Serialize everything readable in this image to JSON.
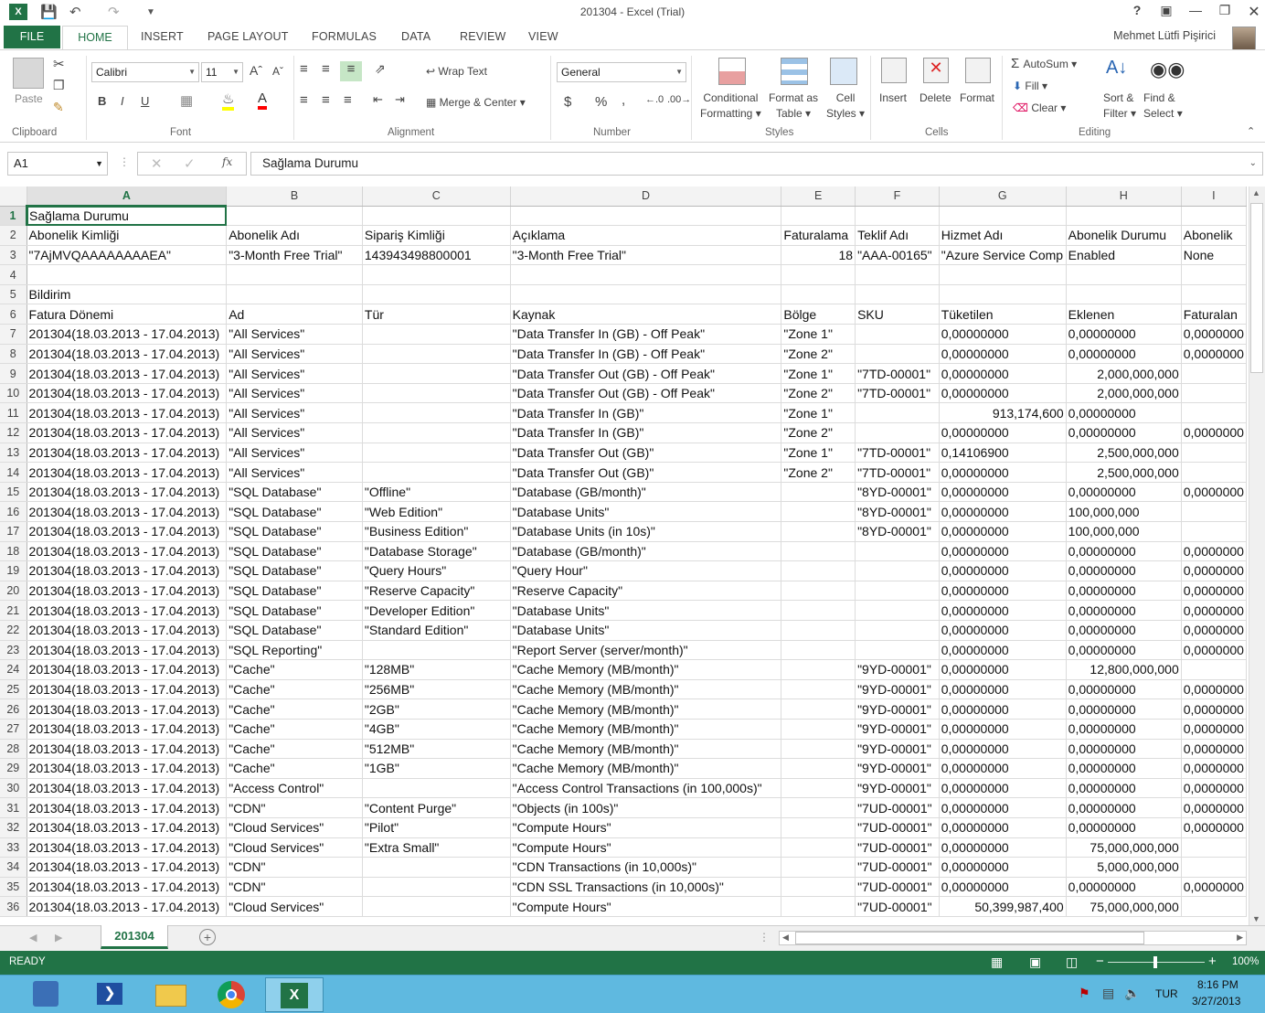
{
  "window": {
    "title": "201304 - Excel (Trial)",
    "user": "Mehmet Lütfi Pişirici"
  },
  "tabs": [
    "FILE",
    "HOME",
    "INSERT",
    "PAGE LAYOUT",
    "FORMULAS",
    "DATA",
    "REVIEW",
    "VIEW"
  ],
  "ribbon": {
    "clipboard": {
      "label": "Clipboard",
      "paste": "Paste"
    },
    "font": {
      "label": "Font",
      "name": "Calibri",
      "size": "11",
      "bold": "B",
      "italic": "I",
      "underline": "U"
    },
    "alignment": {
      "label": "Alignment",
      "wrap_text": "Wrap Text",
      "merge_center": "Merge & Center"
    },
    "number": {
      "label": "Number",
      "format": "General",
      "currency": "$",
      "percent": "%",
      "comma": ","
    },
    "styles": {
      "label": "Styles",
      "conditional_1": "Conditional",
      "conditional_2": "Formatting",
      "format_table_1": "Format as",
      "format_table_2": "Table",
      "cell_styles_1": "Cell",
      "cell_styles_2": "Styles"
    },
    "cells": {
      "label": "Cells",
      "insert": "Insert",
      "delete": "Delete",
      "format": "Format"
    },
    "editing": {
      "label": "Editing",
      "autosum": "AutoSum",
      "fill": "Fill",
      "clear": "Clear",
      "sort_1": "Sort &",
      "sort_2": "Filter",
      "find_1": "Find &",
      "find_2": "Select"
    }
  },
  "formula_bar": {
    "name_box": "A1",
    "fx": "fx",
    "content": "Sağlama Durumu"
  },
  "columns": [
    "A",
    "B",
    "C",
    "D",
    "E",
    "F",
    "G",
    "H",
    "I"
  ],
  "rows": [
    {
      "n": "1",
      "c": [
        "Sağlama Durumu",
        "",
        "",
        "",
        "",
        "",
        "",
        "",
        ""
      ]
    },
    {
      "n": "2",
      "c": [
        "Abonelik Kimliği",
        "Abonelik Adı",
        "Sipariş Kimliği",
        "Açıklama",
        "Faturalama",
        "Teklif Adı",
        "Hizmet Adı",
        "Abonelik Durumu",
        "Abonelik"
      ]
    },
    {
      "n": "3",
      "c": [
        "\"7AjMVQAAAAAAAAEA\"",
        "\"3-Month Free Trial\"",
        "143943498800001",
        "\"3-Month Free Trial\"",
        "18",
        "\"AAA-00165\"",
        "\"Azure Service Comp",
        "Enabled",
        "None"
      ]
    },
    {
      "n": "4",
      "c": [
        "",
        "",
        "",
        "",
        "",
        "",
        "",
        "",
        ""
      ]
    },
    {
      "n": "5",
      "c": [
        "Bildirim",
        "",
        "",
        "",
        "",
        "",
        "",
        "",
        ""
      ]
    },
    {
      "n": "6",
      "c": [
        "Fatura Dönemi",
        "Ad",
        "Tür",
        "Kaynak",
        "Bölge",
        "SKU",
        "Tüketilen",
        "Eklenen",
        "Faturalan"
      ]
    },
    {
      "n": "7",
      "c": [
        "201304(18.03.2013 - 17.04.2013)",
        "\"All Services\"",
        "",
        "\"Data Transfer In (GB) - Off Peak\"",
        "\"Zone 1\"",
        "",
        "0,00000000",
        "0,00000000",
        "0,0000000"
      ]
    },
    {
      "n": "8",
      "c": [
        "201304(18.03.2013 - 17.04.2013)",
        "\"All Services\"",
        "",
        "\"Data Transfer In (GB) - Off Peak\"",
        "\"Zone 2\"",
        "",
        "0,00000000",
        "0,00000000",
        "0,0000000"
      ]
    },
    {
      "n": "9",
      "c": [
        "201304(18.03.2013 - 17.04.2013)",
        "\"All Services\"",
        "",
        "\"Data Transfer Out (GB) - Off Peak\"",
        "\"Zone 1\"",
        "\"7TD-00001\"",
        "0,00000000",
        "2,000,000,000",
        ""
      ]
    },
    {
      "n": "10",
      "c": [
        "201304(18.03.2013 - 17.04.2013)",
        "\"All Services\"",
        "",
        "\"Data Transfer Out (GB) - Off Peak\"",
        "\"Zone 2\"",
        "\"7TD-00001\"",
        "0,00000000",
        "2,000,000,000",
        ""
      ]
    },
    {
      "n": "11",
      "c": [
        "201304(18.03.2013 - 17.04.2013)",
        "\"All Services\"",
        "",
        "\"Data Transfer In (GB)\"",
        "\"Zone 1\"",
        "",
        "913,174,600",
        "0,00000000",
        ""
      ]
    },
    {
      "n": "12",
      "c": [
        "201304(18.03.2013 - 17.04.2013)",
        "\"All Services\"",
        "",
        "\"Data Transfer In (GB)\"",
        "\"Zone 2\"",
        "",
        "0,00000000",
        "0,00000000",
        "0,0000000"
      ]
    },
    {
      "n": "13",
      "c": [
        "201304(18.03.2013 - 17.04.2013)",
        "\"All Services\"",
        "",
        "\"Data Transfer Out (GB)\"",
        "\"Zone 1\"",
        "\"7TD-00001\"",
        "0,14106900",
        "2,500,000,000",
        ""
      ]
    },
    {
      "n": "14",
      "c": [
        "201304(18.03.2013 - 17.04.2013)",
        "\"All Services\"",
        "",
        "\"Data Transfer Out (GB)\"",
        "\"Zone 2\"",
        "\"7TD-00001\"",
        "0,00000000",
        "2,500,000,000",
        ""
      ]
    },
    {
      "n": "15",
      "c": [
        "201304(18.03.2013 - 17.04.2013)",
        "\"SQL Database\"",
        "\"Offline\"",
        "\"Database (GB/month)\"",
        "",
        "\"8YD-00001\"",
        "0,00000000",
        "0,00000000",
        "0,0000000"
      ]
    },
    {
      "n": "16",
      "c": [
        "201304(18.03.2013 - 17.04.2013)",
        "\"SQL Database\"",
        "\"Web Edition\"",
        "\"Database Units\"",
        "",
        "\"8YD-00001\"",
        "0,00000000",
        "100,000,000",
        ""
      ]
    },
    {
      "n": "17",
      "c": [
        "201304(18.03.2013 - 17.04.2013)",
        "\"SQL Database\"",
        "\"Business Edition\"",
        "\"Database Units (in 10s)\"",
        "",
        "\"8YD-00001\"",
        "0,00000000",
        "100,000,000",
        ""
      ]
    },
    {
      "n": "18",
      "c": [
        "201304(18.03.2013 - 17.04.2013)",
        "\"SQL Database\"",
        "\"Database Storage\"",
        "\"Database (GB/month)\"",
        "",
        "",
        "0,00000000",
        "0,00000000",
        "0,0000000"
      ]
    },
    {
      "n": "19",
      "c": [
        "201304(18.03.2013 - 17.04.2013)",
        "\"SQL Database\"",
        "\"Query Hours\"",
        "\"Query Hour\"",
        "",
        "",
        "0,00000000",
        "0,00000000",
        "0,0000000"
      ]
    },
    {
      "n": "20",
      "c": [
        "201304(18.03.2013 - 17.04.2013)",
        "\"SQL Database\"",
        "\"Reserve Capacity\"",
        "\"Reserve Capacity\"",
        "",
        "",
        "0,00000000",
        "0,00000000",
        "0,0000000"
      ]
    },
    {
      "n": "21",
      "c": [
        "201304(18.03.2013 - 17.04.2013)",
        "\"SQL Database\"",
        "\"Developer Edition\"",
        "\"Database Units\"",
        "",
        "",
        "0,00000000",
        "0,00000000",
        "0,0000000"
      ]
    },
    {
      "n": "22",
      "c": [
        "201304(18.03.2013 - 17.04.2013)",
        "\"SQL Database\"",
        "\"Standard Edition\"",
        "\"Database Units\"",
        "",
        "",
        "0,00000000",
        "0,00000000",
        "0,0000000"
      ]
    },
    {
      "n": "23",
      "c": [
        "201304(18.03.2013 - 17.04.2013)",
        "\"SQL Reporting\"",
        "",
        "\"Report Server (server/month)\"",
        "",
        "",
        "0,00000000",
        "0,00000000",
        "0,0000000"
      ]
    },
    {
      "n": "24",
      "c": [
        "201304(18.03.2013 - 17.04.2013)",
        "\"Cache\"",
        "\"128MB\"",
        "\"Cache Memory (MB/month)\"",
        "",
        "\"9YD-00001\"",
        "0,00000000",
        "12,800,000,000",
        ""
      ]
    },
    {
      "n": "25",
      "c": [
        "201304(18.03.2013 - 17.04.2013)",
        "\"Cache\"",
        "\"256MB\"",
        "\"Cache Memory (MB/month)\"",
        "",
        "\"9YD-00001\"",
        "0,00000000",
        "0,00000000",
        "0,0000000"
      ]
    },
    {
      "n": "26",
      "c": [
        "201304(18.03.2013 - 17.04.2013)",
        "\"Cache\"",
        "\"2GB\"",
        "\"Cache Memory (MB/month)\"",
        "",
        "\"9YD-00001\"",
        "0,00000000",
        "0,00000000",
        "0,0000000"
      ]
    },
    {
      "n": "27",
      "c": [
        "201304(18.03.2013 - 17.04.2013)",
        "\"Cache\"",
        "\"4GB\"",
        "\"Cache Memory (MB/month)\"",
        "",
        "\"9YD-00001\"",
        "0,00000000",
        "0,00000000",
        "0,0000000"
      ]
    },
    {
      "n": "28",
      "c": [
        "201304(18.03.2013 - 17.04.2013)",
        "\"Cache\"",
        "\"512MB\"",
        "\"Cache Memory (MB/month)\"",
        "",
        "\"9YD-00001\"",
        "0,00000000",
        "0,00000000",
        "0,0000000"
      ]
    },
    {
      "n": "29",
      "c": [
        "201304(18.03.2013 - 17.04.2013)",
        "\"Cache\"",
        "\"1GB\"",
        "\"Cache Memory (MB/month)\"",
        "",
        "\"9YD-00001\"",
        "0,00000000",
        "0,00000000",
        "0,0000000"
      ]
    },
    {
      "n": "30",
      "c": [
        "201304(18.03.2013 - 17.04.2013)",
        "\"Access Control\"",
        "",
        "\"Access Control Transactions (in 100,000s)\"",
        "",
        "\"9YD-00001\"",
        "0,00000000",
        "0,00000000",
        "0,0000000"
      ]
    },
    {
      "n": "31",
      "c": [
        "201304(18.03.2013 - 17.04.2013)",
        "\"CDN\"",
        "\"Content Purge\"",
        "\"Objects (in 100s)\"",
        "",
        "\"7UD-00001\"",
        "0,00000000",
        "0,00000000",
        "0,0000000"
      ]
    },
    {
      "n": "32",
      "c": [
        "201304(18.03.2013 - 17.04.2013)",
        "\"Cloud Services\"",
        "\"Pilot\"",
        "\"Compute Hours\"",
        "",
        "\"7UD-00001\"",
        "0,00000000",
        "0,00000000",
        "0,0000000"
      ]
    },
    {
      "n": "33",
      "c": [
        "201304(18.03.2013 - 17.04.2013)",
        "\"Cloud Services\"",
        "\"Extra Small\"",
        "\"Compute Hours\"",
        "",
        "\"7UD-00001\"",
        "0,00000000",
        "75,000,000,000",
        ""
      ]
    },
    {
      "n": "34",
      "c": [
        "201304(18.03.2013 - 17.04.2013)",
        "\"CDN\"",
        "",
        "\"CDN Transactions (in 10,000s)\"",
        "",
        "\"7UD-00001\"",
        "0,00000000",
        "5,000,000,000",
        ""
      ]
    },
    {
      "n": "35",
      "c": [
        "201304(18.03.2013 - 17.04.2013)",
        "\"CDN\"",
        "",
        "\"CDN SSL Transactions (in 10,000s)\"",
        "",
        "\"7UD-00001\"",
        "0,00000000",
        "0,00000000",
        "0,0000000"
      ]
    },
    {
      "n": "36",
      "c": [
        "201304(18.03.2013 - 17.04.2013)",
        "\"Cloud Services\"",
        "",
        "\"Compute Hours\"",
        "",
        "\"7UD-00001\"",
        "50,399,987,400",
        "75,000,000,000",
        ""
      ]
    }
  ],
  "sheet_tab": "201304",
  "status": {
    "ready": "READY",
    "zoom": "100%"
  },
  "taskbar": {
    "lang": "TUR",
    "time": "8:16 PM",
    "date": "3/27/2013"
  },
  "colors": {
    "excel_green": "#217346",
    "taskbar": "#5fb9e0"
  }
}
